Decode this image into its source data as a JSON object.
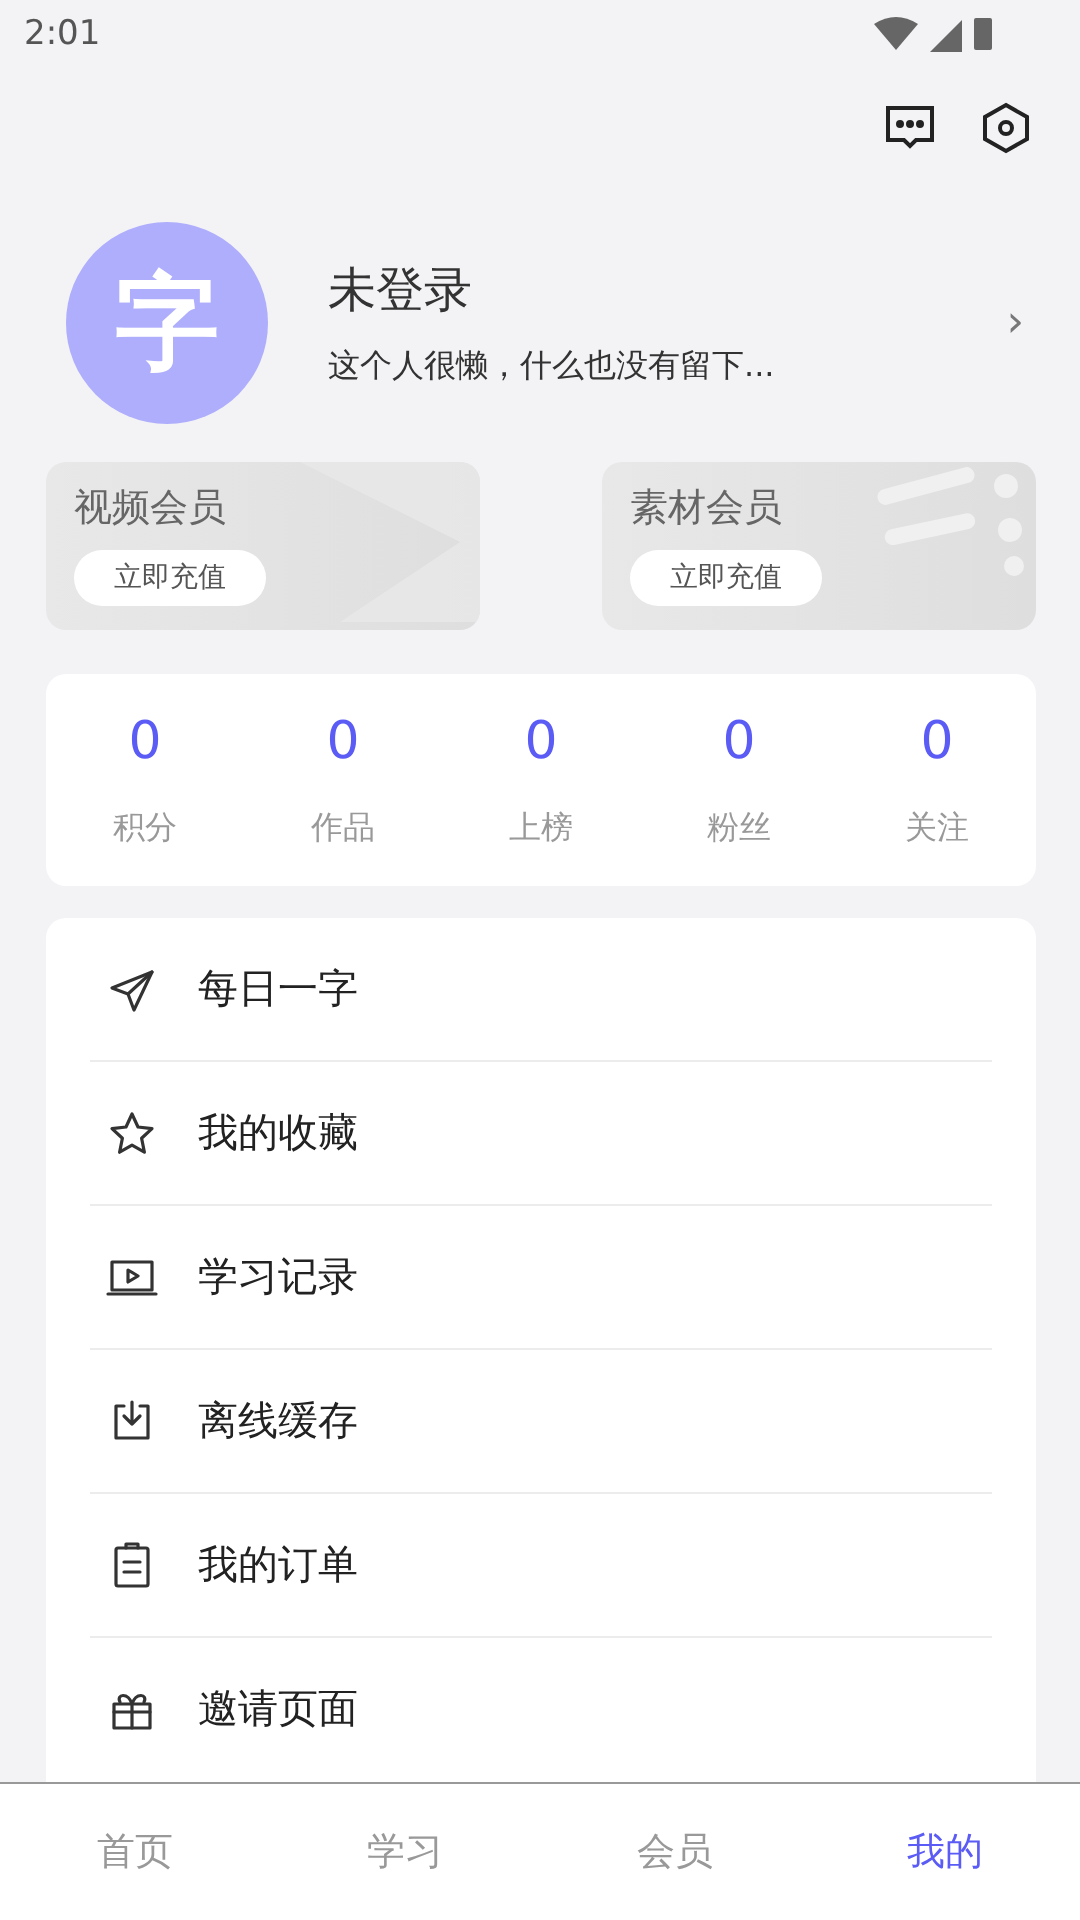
{
  "status_bar": {
    "time": "2:01"
  },
  "profile": {
    "avatar_text": "字",
    "name": "未登录",
    "bio": "这个人很懒，什么也没有留下...",
    "chevron": "›"
  },
  "memberships": [
    {
      "title": "视频会员",
      "button": "立即充值"
    },
    {
      "title": "素材会员",
      "button": "立即充值"
    }
  ],
  "stats": [
    {
      "value": "0",
      "label": "积分"
    },
    {
      "value": "0",
      "label": "作品"
    },
    {
      "value": "0",
      "label": "上榜"
    },
    {
      "value": "0",
      "label": "粉丝"
    },
    {
      "value": "0",
      "label": "关注"
    }
  ],
  "menu": [
    {
      "label": "每日一字"
    },
    {
      "label": "我的收藏"
    },
    {
      "label": "学习记录"
    },
    {
      "label": "离线缓存"
    },
    {
      "label": "我的订单"
    },
    {
      "label": "邀请页面"
    }
  ],
  "tabs": [
    {
      "label": "首页",
      "selected": false
    },
    {
      "label": "学习",
      "selected": false
    },
    {
      "label": "会员",
      "selected": false
    },
    {
      "label": "我的",
      "selected": true
    }
  ]
}
